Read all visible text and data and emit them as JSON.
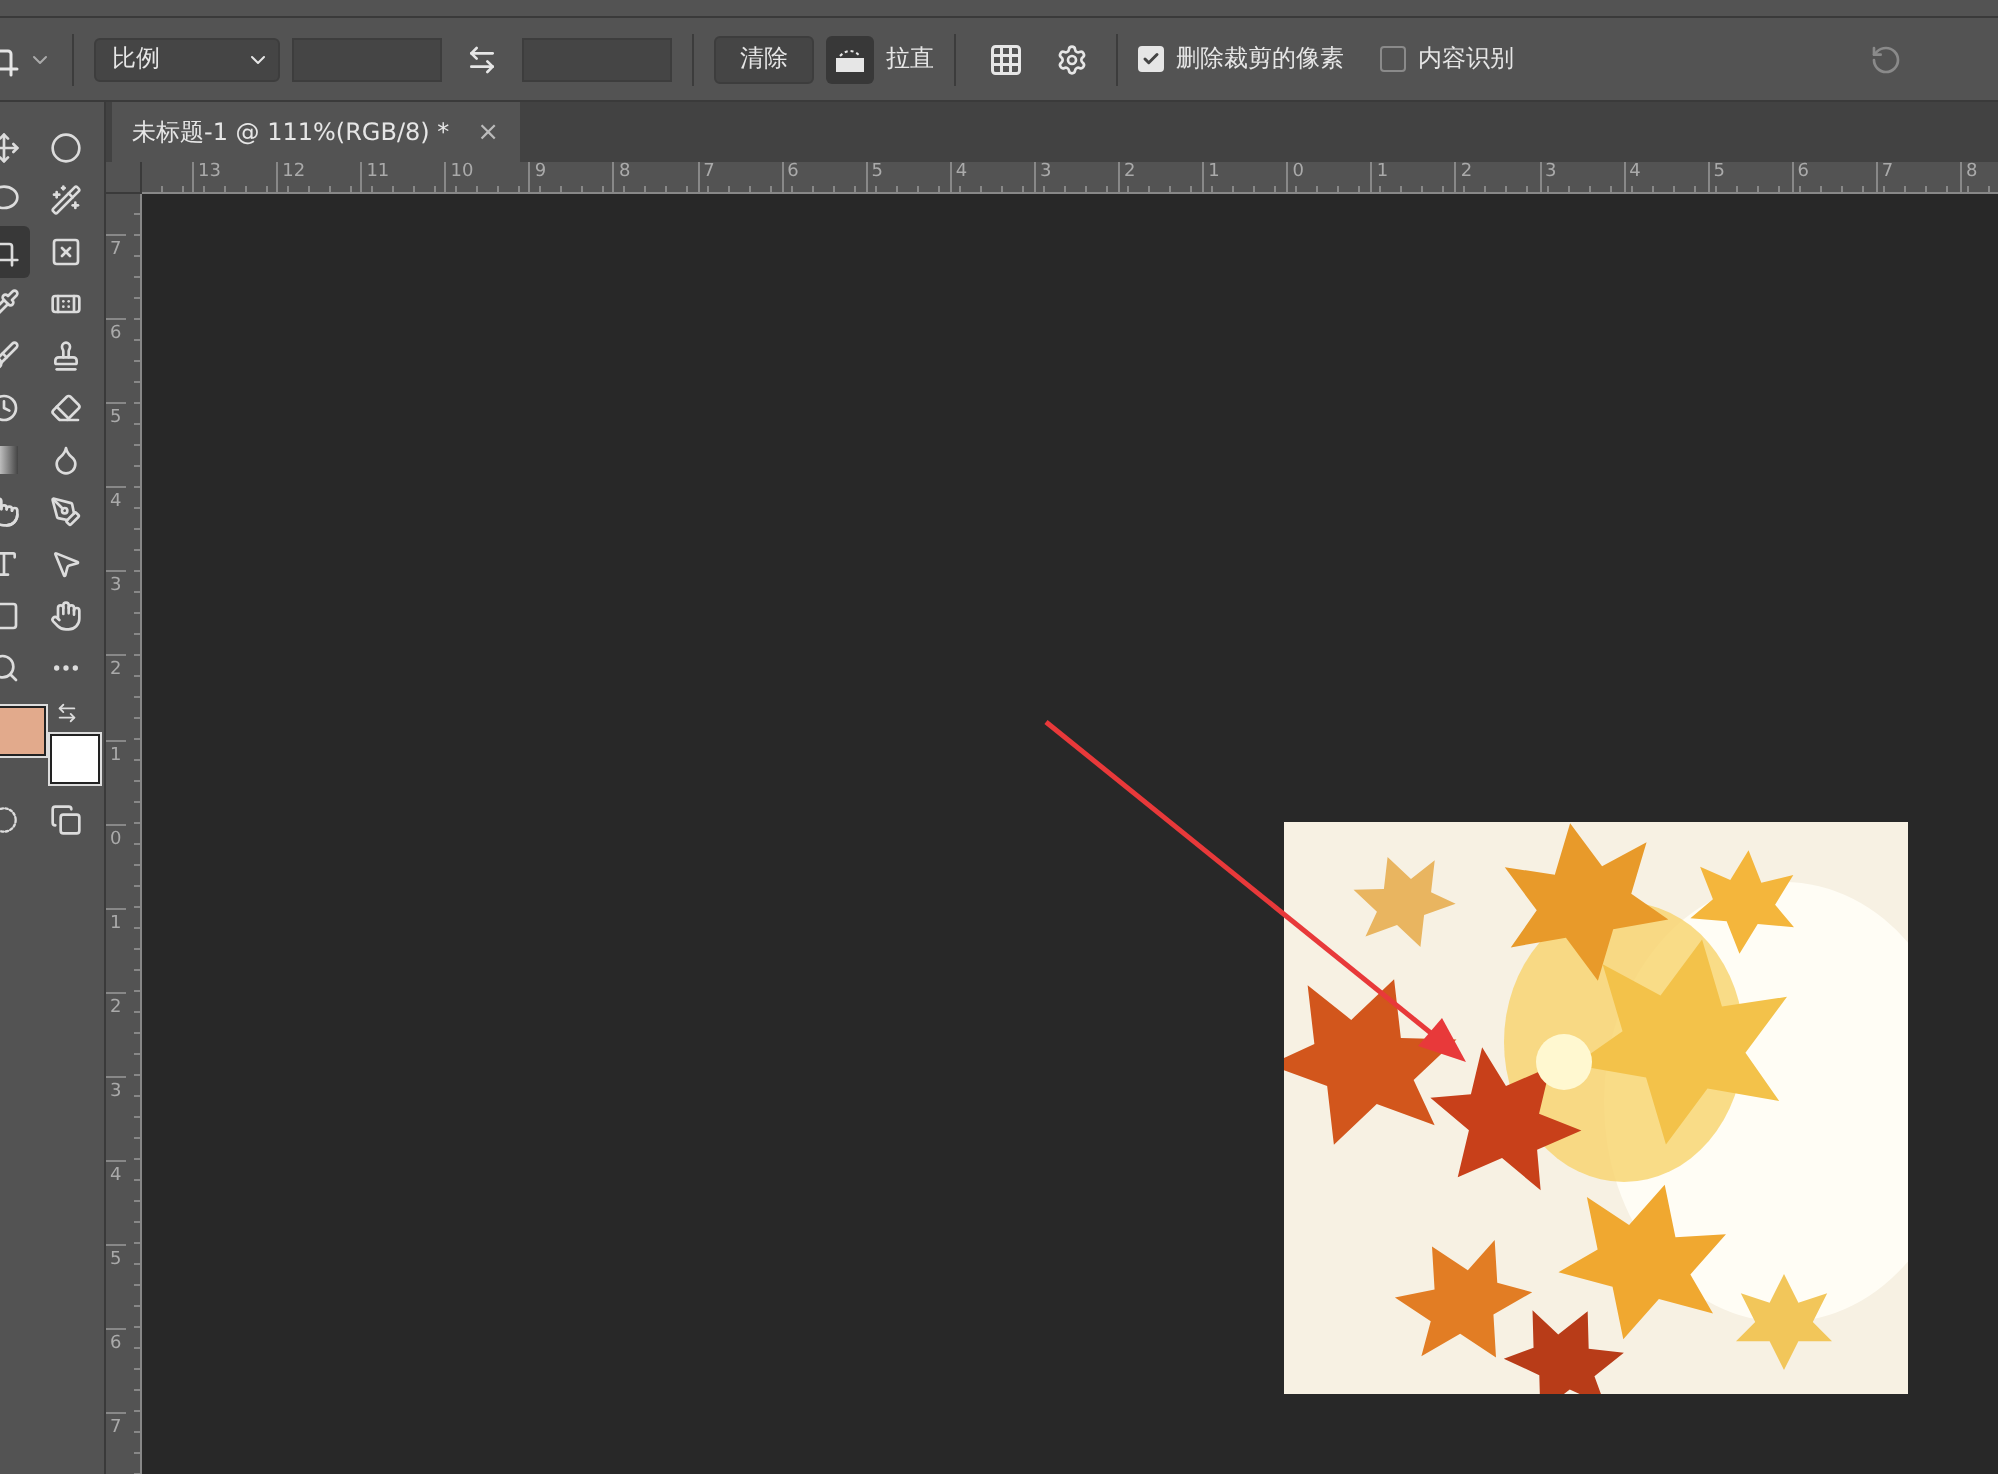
{
  "options_bar": {
    "ratio_select": "比例",
    "clear_button": "清除",
    "straighten_label": "拉直",
    "straighten_active": true,
    "checkboxes": [
      {
        "label": "删除裁剪的像素",
        "checked": true
      },
      {
        "label": "内容识别",
        "checked": false
      }
    ]
  },
  "document_tabs": [
    {
      "title": "未标题-1 @ 111%(RGB/8) *",
      "close": "×",
      "selected": true
    }
  ],
  "ruler_horizontal": [
    "13",
    "12",
    "11",
    "10",
    "9",
    "8",
    "7",
    "6",
    "5",
    "4",
    "3",
    "2",
    "1",
    "0",
    "1",
    "2",
    "3",
    "4",
    "5",
    "6",
    "7",
    "8"
  ],
  "ruler_vertical": [
    "7",
    "6",
    "5",
    "4",
    "3",
    "2",
    "1",
    "0",
    "1",
    "2",
    "3",
    "4",
    "5",
    "6",
    "7"
  ],
  "tools": [
    {
      "selected": false
    },
    {
      "selected": false
    },
    {
      "selected": false
    },
    {
      "selected": false
    },
    {
      "selected": true
    },
    {
      "selected": false
    },
    {
      "selected": false
    },
    {
      "selected": false
    },
    {
      "selected": false
    },
    {
      "selected": false
    },
    {
      "selected": false
    },
    {
      "selected": false
    },
    {
      "selected": false
    },
    {
      "selected": false
    },
    {
      "selected": false
    },
    {
      "selected": false
    },
    {
      "selected": false
    },
    {
      "selected": false
    },
    {
      "selected": false
    },
    {
      "selected": false
    },
    {
      "selected": false
    },
    {
      "selected": false
    }
  ],
  "canvas": {
    "annotation_arrow": true
  }
}
